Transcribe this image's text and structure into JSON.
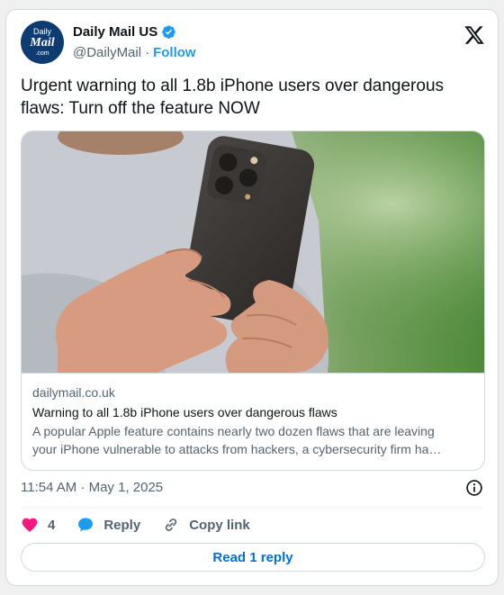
{
  "account": {
    "display_name": "Daily Mail US",
    "handle": "@DailyMail",
    "separator": "·",
    "follow_label": "Follow",
    "avatar_lines": [
      "Daily",
      "Mail",
      ".com"
    ],
    "verified": true,
    "avatar_color": "#0f3b73"
  },
  "tweet": {
    "text": "Urgent warning to all 1.8b iPhone users over dangerous flaws: Turn off the feature NOW"
  },
  "card": {
    "image": "hands-holding-iphone-photo",
    "domain": "dailymail.co.uk",
    "title": "Warning to all 1.8b iPhone users over dangerous flaws",
    "description_line1": "A popular Apple feature contains nearly two dozen flaws that are leaving",
    "description_line2": "your iPhone vulnerable to attacks from hackers, a cybersecurity firm ha…"
  },
  "meta": {
    "timestamp": "11:54 AM · May 1, 2025"
  },
  "actions": {
    "like_count": "4",
    "reply_label": "Reply",
    "copy_link_label": "Copy link"
  },
  "read_replies_label": "Read 1 reply",
  "colors": {
    "accent": "#1d9bf0",
    "link": "#006fd6",
    "like": "#f91880",
    "muted": "#536471",
    "border": "#cfd9de"
  }
}
